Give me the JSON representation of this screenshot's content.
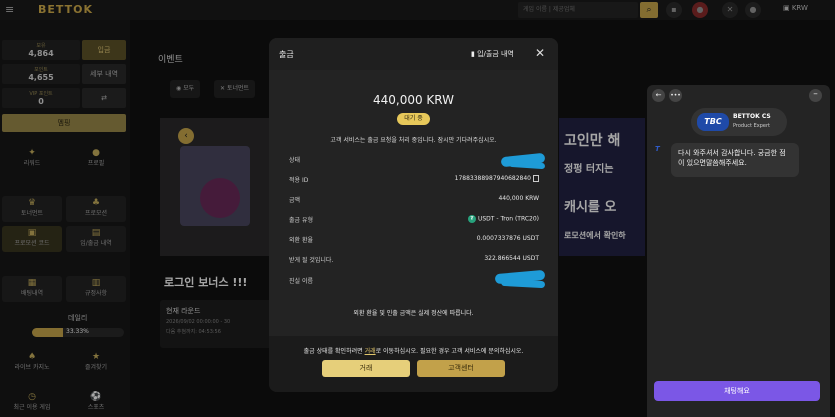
{
  "topbar": {
    "logo": "BETTOK",
    "search_placeholder": "게임 이름 | 제공업체",
    "currency": "KRW"
  },
  "sidebar": {
    "stat1_label": "보유",
    "stat1_value": "4,864",
    "stat1_button": "입금",
    "stat2_label": "포인트",
    "stat2_value": "4,655",
    "stat2_button": "세부 내역",
    "stat3_label": "VIP 포인트",
    "stat3_value": "0",
    "login_button": "멤핑",
    "menu": [
      {
        "label": "리워드"
      },
      {
        "label": "프로필"
      },
      {
        "label": "토너먼트"
      },
      {
        "label": "프로모션"
      },
      {
        "label": "프로모션 코드"
      },
      {
        "label": "입/출금 내역"
      },
      {
        "label": "배팅내역"
      },
      {
        "label": "규정사항"
      }
    ],
    "vip_name": "데일리",
    "vip_pct": "33.33%",
    "vip_fill": 0.3333,
    "bottom": [
      "라이브 카지노",
      "즐겨찾기",
      "최근 이용 게임",
      "스포츠"
    ]
  },
  "main": {
    "event_title": "이벤트",
    "categories": [
      "모두",
      "토너먼트"
    ],
    "banner_lines": [
      "고인만 해",
      "정펑 터지는",
      "캐시를 오",
      "로모션에서 확인하"
    ],
    "bonus_title": "로그인 보너스 !!!",
    "round_title": "현재 라운드",
    "round_date": "2026/09/02 00:00:00 - 30",
    "round_remaining": "다음 추첨까지: 04:53:56"
  },
  "modal": {
    "title": "출금",
    "history_link": "입/출금 내역",
    "amount": "440,000 KRW",
    "status_badge": "대기 중",
    "notice": "고객 서비스는 출금 요청을 처리 중입니다. 잠시만 기다려주십시오.",
    "rows": [
      {
        "key": "상태",
        "value": ""
      },
      {
        "key": "적용 ID",
        "value": "17883388987940682840"
      },
      {
        "key": "금액",
        "value": "440,000 KRW"
      },
      {
        "key": "출금 유형",
        "value": "USDT - Tron (TRC20)"
      },
      {
        "key": "외환 환율",
        "value": "0.0007337876 USDT"
      },
      {
        "key": "받게 될 것입니다.",
        "value": "322.866544 USDT"
      },
      {
        "key": "진실 이름",
        "value": ""
      }
    ],
    "fx_note": "외환 환율 및 인출 금액은 실제 정산에 따릅니다.",
    "bottom_note_pre": "출금 상태를 확인하려면",
    "bottom_note_link": "거래",
    "bottom_note_post": "로 이동하십시오. 필요한 경우 고객 서비스에 문의하십시오.",
    "btn_trade": "거래",
    "btn_support": "고객센터"
  },
  "chat": {
    "agent_logo": "TBC",
    "agent_name": "BETTOK CS",
    "agent_role": "Product Expert",
    "message": "다시 와주셔서 감사합니다. 궁금한 점이 있으면말씀해주세요.",
    "chat_button": "채팅해요"
  }
}
